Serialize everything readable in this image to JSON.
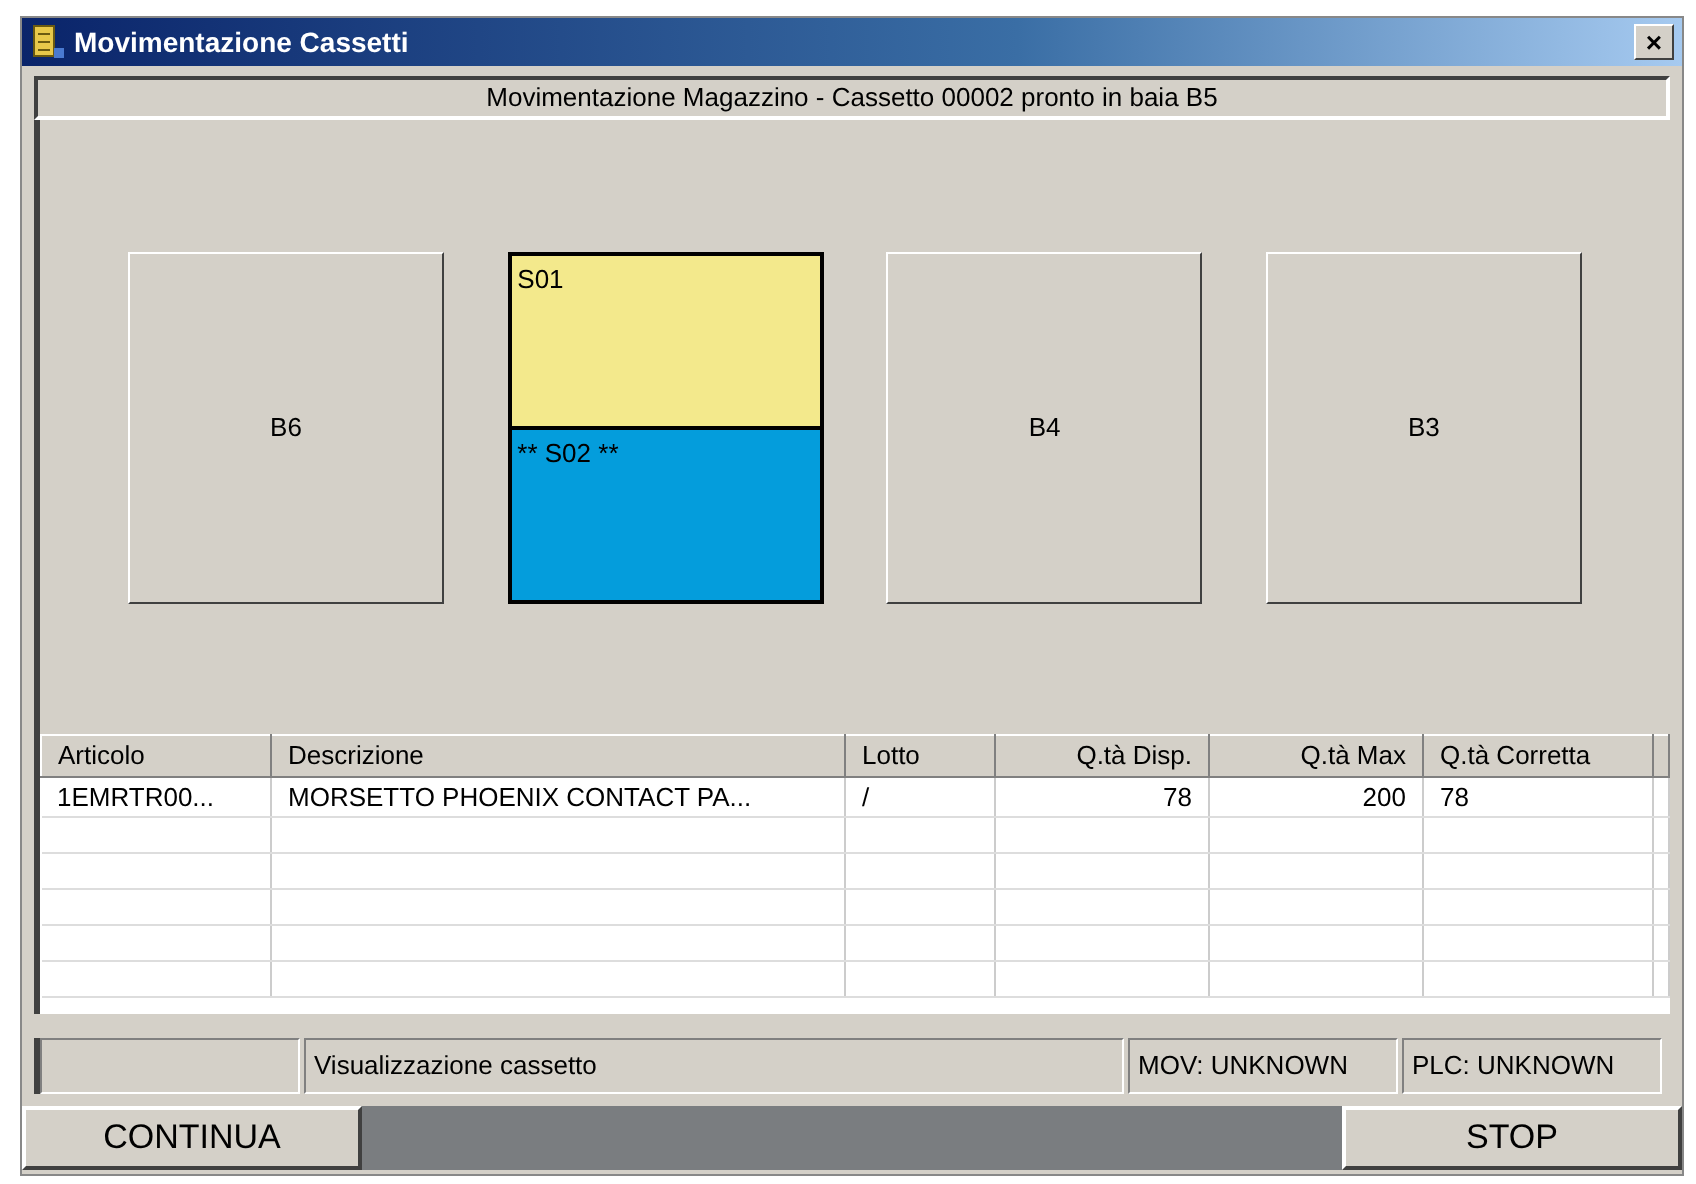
{
  "window": {
    "title": "Movimentazione Cassetti",
    "close": "×"
  },
  "header": "Movimentazione Magazzino - Cassetto 00002 pronto in baia B5",
  "bays": [
    {
      "kind": "bay",
      "label": "B6"
    },
    {
      "kind": "drawer",
      "sections": [
        {
          "label": "S01",
          "color": "#f3e98c"
        },
        {
          "label": "** S02 **",
          "color": "#049ddc"
        }
      ]
    },
    {
      "kind": "bay",
      "label": "B4"
    },
    {
      "kind": "bay",
      "label": "B3"
    }
  ],
  "table": {
    "columns": [
      {
        "label": "Articolo",
        "kind": "text"
      },
      {
        "label": "Descrizione",
        "kind": "text"
      },
      {
        "label": "Lotto",
        "kind": "text"
      },
      {
        "label": "Q.tà Disp.",
        "kind": "number"
      },
      {
        "label": "Q.tà Max",
        "kind": "number"
      },
      {
        "label": "Q.tà Corretta",
        "kind": "text"
      }
    ],
    "rows": [
      [
        "1EMRTR00...",
        "MORSETTO PHOENIX CONTACT PA...",
        "/",
        "78",
        "200",
        "78"
      ]
    ]
  },
  "status_bar": [
    "Visualizzazione cassetto",
    "MOV: UNKNOWN",
    "PLC: UNKNOWN"
  ],
  "buttons": {
    "left": "CONTINUA",
    "right": "STOP"
  }
}
